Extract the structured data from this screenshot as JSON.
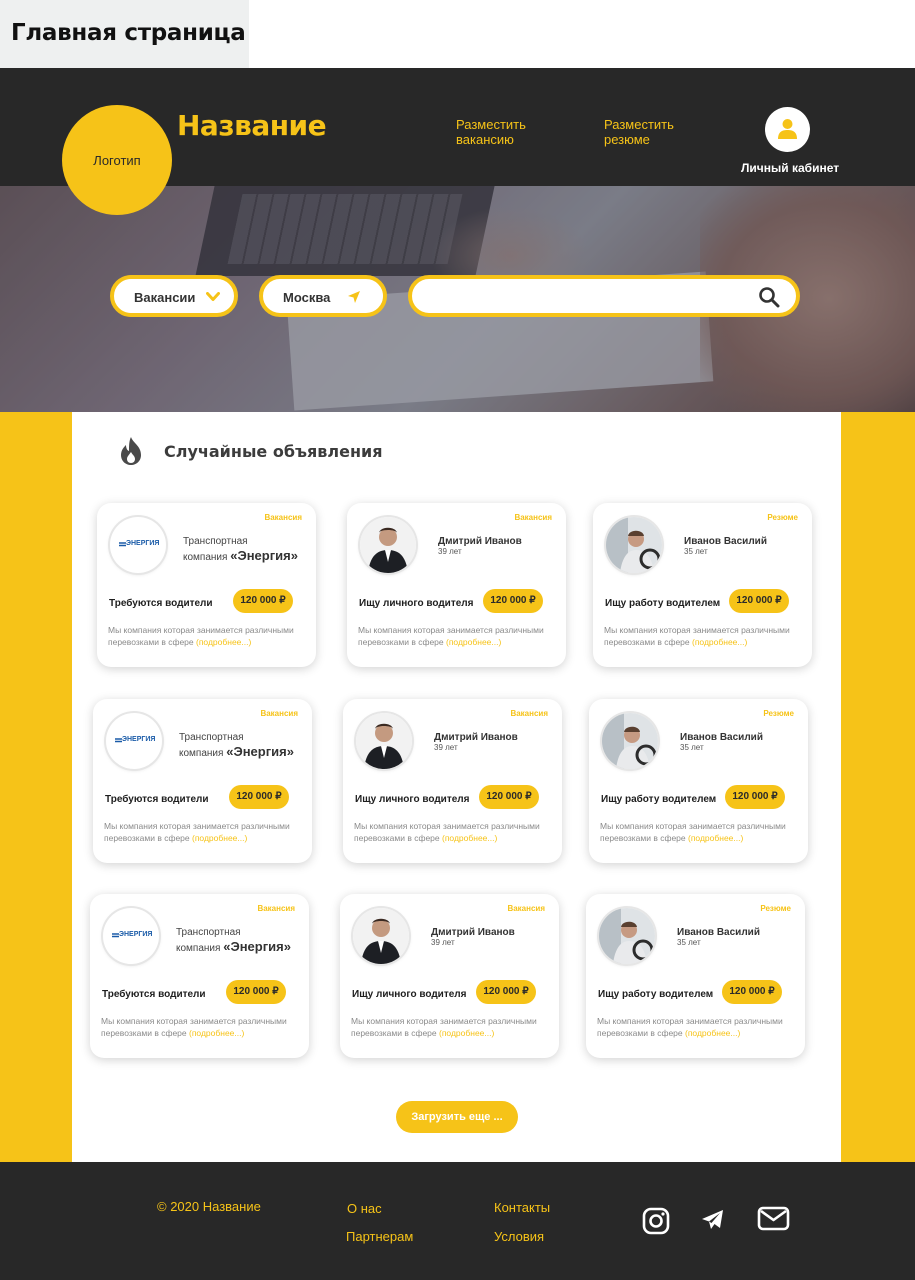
{
  "page_label": "Главная страница",
  "header": {
    "logo_text": "Логотип",
    "site_title": "Название",
    "nav": [
      {
        "line1": "Разместить",
        "line2": "вакансию"
      },
      {
        "line1": "Разместить",
        "line2": "резюме"
      }
    ],
    "cabinet_label": "Личный кабинет",
    "user_icon": "user-icon"
  },
  "search": {
    "category": "Вакансии",
    "city": "Москва",
    "query_value": "",
    "search_icon": "search-icon"
  },
  "section": {
    "title": "Случайные объявления",
    "icon": "fire-icon"
  },
  "cards": [
    {
      "tag": "Вакансия",
      "type": "company",
      "company_line1": "Транспортная",
      "company_line2_prefix": "компания",
      "company_name": "«Энергия»",
      "logo_text": "ЭНЕРГИЯ",
      "title": "Требуются водители",
      "price": "120 000 ₽",
      "desc_line1": "Мы компания которая занимается различными",
      "desc_line2": "перевозками в сфере",
      "more": "(подробнее...)"
    },
    {
      "tag": "Вакансия",
      "type": "person",
      "name": "Дмитрий Иванов",
      "age": "39 лет",
      "title": "Ищу личного водителя",
      "price": "120 000 ₽",
      "desc_line1": "Мы компания которая занимается различными",
      "desc_line2": "перевозками в сфере",
      "more": "(подробнее...)"
    },
    {
      "tag": "Резюме",
      "type": "driver",
      "name": "Иванов Василий",
      "age": "35 лет",
      "title": "Ищу работу водителем",
      "price": "120 000 ₽",
      "desc_line1": "Мы компания которая занимается различными",
      "desc_line2": "перевозками в сфере",
      "more": "(подробнее...)"
    },
    {
      "tag": "Вакансия",
      "type": "company",
      "company_line1": "Транспортная",
      "company_line2_prefix": "компания",
      "company_name": "«Энергия»",
      "logo_text": "ЭНЕРГИЯ",
      "title": "Требуются водители",
      "price": "120 000 ₽",
      "desc_line1": "Мы компания которая занимается различными",
      "desc_line2": "перевозками в сфере",
      "more": "(подробнее...)"
    },
    {
      "tag": "Вакансия",
      "type": "person",
      "name": "Дмитрий Иванов",
      "age": "39 лет",
      "title": "Ищу личного водителя",
      "price": "120 000 ₽",
      "desc_line1": "Мы компания которая занимается различными",
      "desc_line2": "перевозками в сфере",
      "more": "(подробнее...)"
    },
    {
      "tag": "Резюме",
      "type": "driver",
      "name": "Иванов Василий",
      "age": "35 лет",
      "title": "Ищу работу водителем",
      "price": "120 000 ₽",
      "desc_line1": "Мы компания которая занимается различными",
      "desc_line2": "перевозками в сфере",
      "more": "(подробнее...)"
    },
    {
      "tag": "Вакансия",
      "type": "company",
      "company_line1": "Транспортная",
      "company_line2_prefix": "компания",
      "company_name": "«Энергия»",
      "logo_text": "ЭНЕРГИЯ",
      "title": "Требуются водители",
      "price": "120 000 ₽",
      "desc_line1": "Мы компания которая занимается различными",
      "desc_line2": "перевозками в сфере",
      "more": "(подробнее...)"
    },
    {
      "tag": "Вакансия",
      "type": "person",
      "name": "Дмитрий Иванов",
      "age": "39 лет",
      "title": "Ищу личного водителя",
      "price": "120 000 ₽",
      "desc_line1": "Мы компания которая занимается различными",
      "desc_line2": "перевозками в сфере",
      "more": "(подробнее...)"
    },
    {
      "tag": "Резюме",
      "type": "driver",
      "name": "Иванов Василий",
      "age": "35 лет",
      "title": "Ищу работу водителем",
      "price": "120 000 ₽",
      "desc_line1": "Мы компания которая занимается различными",
      "desc_line2": "перевозками в сфере",
      "more": "(подробнее...)"
    }
  ],
  "load_more": "Загрузить еще ...",
  "footer": {
    "copyright": "© 2020 Название",
    "links": [
      "О нас",
      "Партнерам",
      "Контакты",
      "Условия"
    ],
    "social_icons": [
      "instagram-icon",
      "telegram-icon",
      "mail-icon"
    ]
  },
  "colors": {
    "accent": "#f6c318",
    "dark": "#282828",
    "text_gray": "#8a8a8a"
  }
}
